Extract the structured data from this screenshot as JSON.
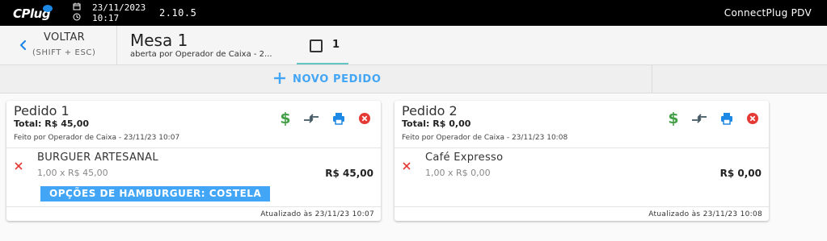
{
  "topbar": {
    "logo_text": "CPlug",
    "date": "23/11/2023",
    "time": "10:17",
    "version": "2.10.5",
    "app_name": "ConnectPlug PDV"
  },
  "header": {
    "back_label": "VOLTAR",
    "back_hint": "(SHIFT + ESC)",
    "table_title": "Mesa 1",
    "table_subtitle": "aberta por Operador de Caixa - 2...",
    "tab_label": "1"
  },
  "actions": {
    "new_order_label": "NOVO PEDIDO"
  },
  "colors": {
    "accent": "#42a5f5",
    "success": "#43a047",
    "danger": "#e53935",
    "tab_underline": "#64c4c4"
  },
  "orders": [
    {
      "title": "Pedido 1",
      "total": "Total: R$ 45,00",
      "meta": "Feito por Operador de Caixa - 23/11/23 10:07",
      "item": {
        "name": "BURGUER ARTESANAL",
        "qty": "1,00 x R$ 45,00",
        "price": "R$ 45,00",
        "option": "OPÇÕES DE HAMBURGUER: COSTELA"
      },
      "updated": "Atualizado às 23/11/23 10:07"
    },
    {
      "title": "Pedido 2",
      "total": "Total: R$ 0,00",
      "meta": "Feito por Operador de Caixa - 23/11/23 10:08",
      "item": {
        "name": "Café Expresso",
        "qty": "1,00 x R$ 0,00",
        "price": "R$ 0,00"
      },
      "updated": "Atualizado às 23/11/23 10:08"
    }
  ],
  "icons": {
    "pay": "dollar-icon",
    "transfer": "transfer-icon",
    "print": "printer-icon",
    "cancel": "cancel-icon",
    "remove": "close-icon"
  }
}
